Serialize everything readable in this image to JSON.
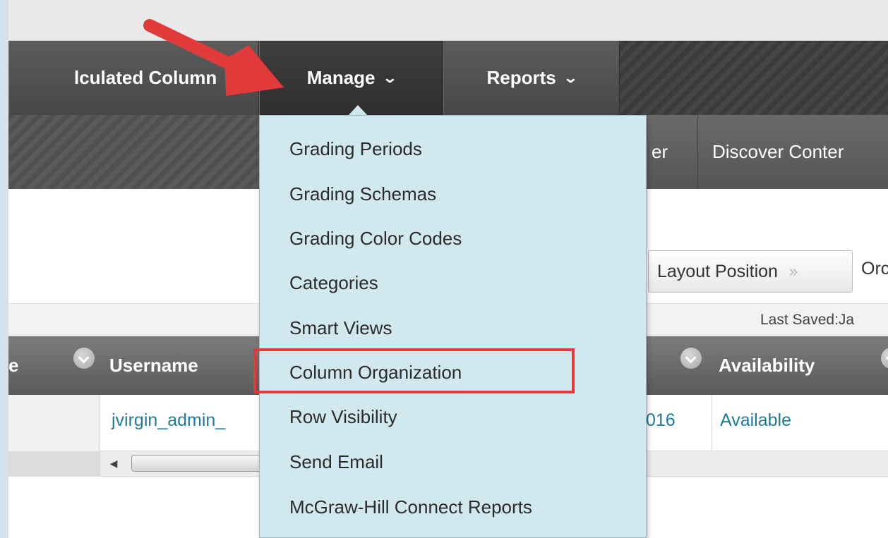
{
  "menubar": {
    "calculated_column": "lculated Column",
    "manage": "Manage",
    "reports": "Reports"
  },
  "subbar": {
    "partial_button": "er",
    "discover_content": "Discover Conter"
  },
  "toolbar": {
    "layout_position": "Layout Position",
    "order_partial": "Orc"
  },
  "status": {
    "last_saved": "Last Saved:Ja"
  },
  "table": {
    "headers": [
      "e",
      "Username",
      "Availability"
    ],
    "row": {
      "username": "jvirgin_admin_",
      "date_partial": "016",
      "availability": "Available"
    }
  },
  "manage_menu": {
    "items": [
      "Grading Periods",
      "Grading Schemas",
      "Grading Color Codes",
      "Categories",
      "Smart Views",
      "Column Organization",
      "Row Visibility",
      "Send Email",
      "McGraw-Hill Connect Reports"
    ],
    "highlighted_item": "Column Organization"
  },
  "colors": {
    "menu_bg": "#454545",
    "dropdown_bg": "#d1e8ef",
    "link": "#1b7e96",
    "annotation_red": "#e03a3a"
  }
}
